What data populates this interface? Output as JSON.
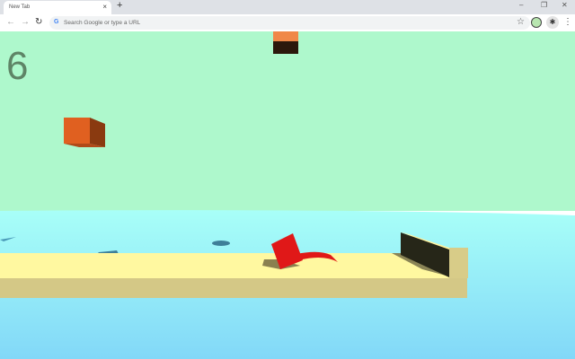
{
  "browser": {
    "tab_title": "New Tab",
    "new_tab": "+",
    "omnibox_placeholder": "Search Google or type a URL",
    "minimize": "–",
    "restore": "❐",
    "close": "✕"
  },
  "game": {
    "score": "6"
  },
  "colors": {
    "sky": "#aef8cc",
    "water": "#a4fcf8",
    "platform": "#fff8a0",
    "player": "#e01818",
    "wall": "#262618",
    "block": "#e06020"
  }
}
